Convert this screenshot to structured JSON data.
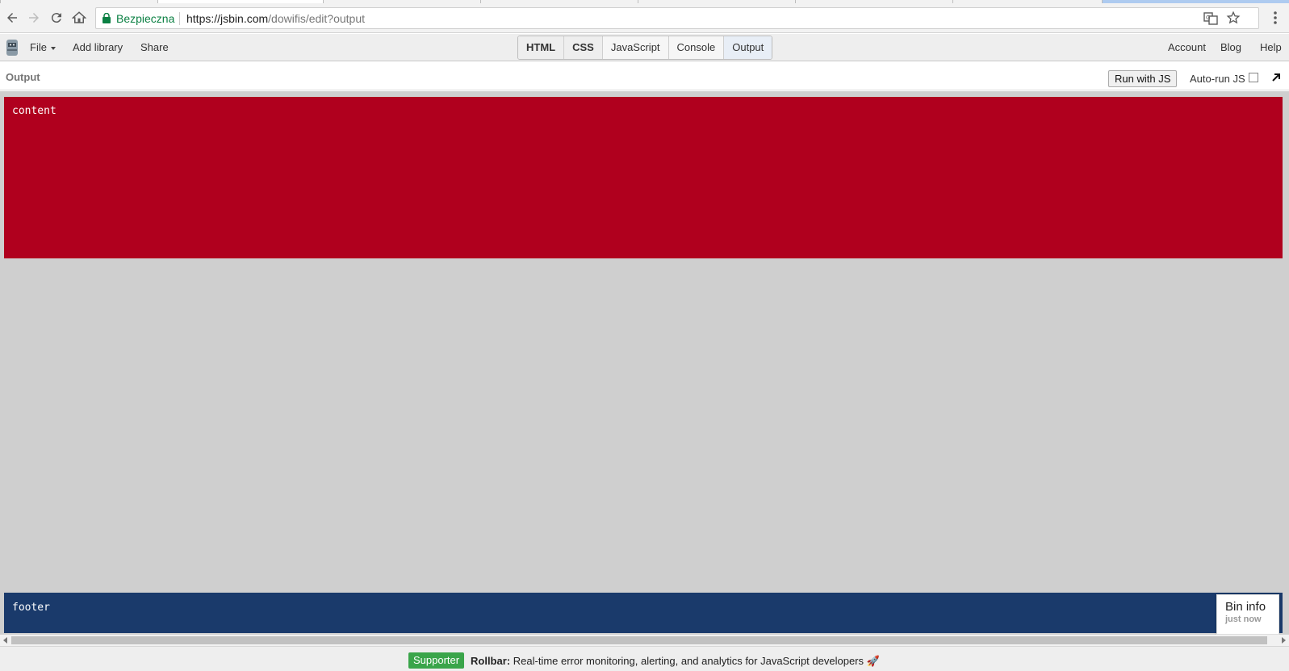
{
  "browser": {
    "secure_label": "Bezpieczna",
    "url_main": "https://jsbin.com",
    "url_path": "/dowifis/edit?output"
  },
  "toolbar": {
    "file": "File",
    "add_library": "Add library",
    "share": "Share",
    "panels": [
      "HTML",
      "CSS",
      "JavaScript",
      "Console",
      "Output"
    ],
    "account": "Account",
    "blog": "Blog",
    "help": "Help"
  },
  "output_header": {
    "label": "Output",
    "run_button": "Run with JS",
    "autorun_label": "Auto-run JS"
  },
  "output": {
    "content_text": "content",
    "footer_text": "footer",
    "content_color": "#b0001e",
    "footer_color": "#1a3a6b",
    "background_color": "#cfcfcf"
  },
  "bin_info": {
    "title": "Bin info",
    "time": "just now"
  },
  "adbar": {
    "badge": "Supporter",
    "brand": "Rollbar:",
    "text": "Real-time error monitoring, alerting, and analytics for JavaScript developers",
    "icon": "rocket-icon"
  }
}
